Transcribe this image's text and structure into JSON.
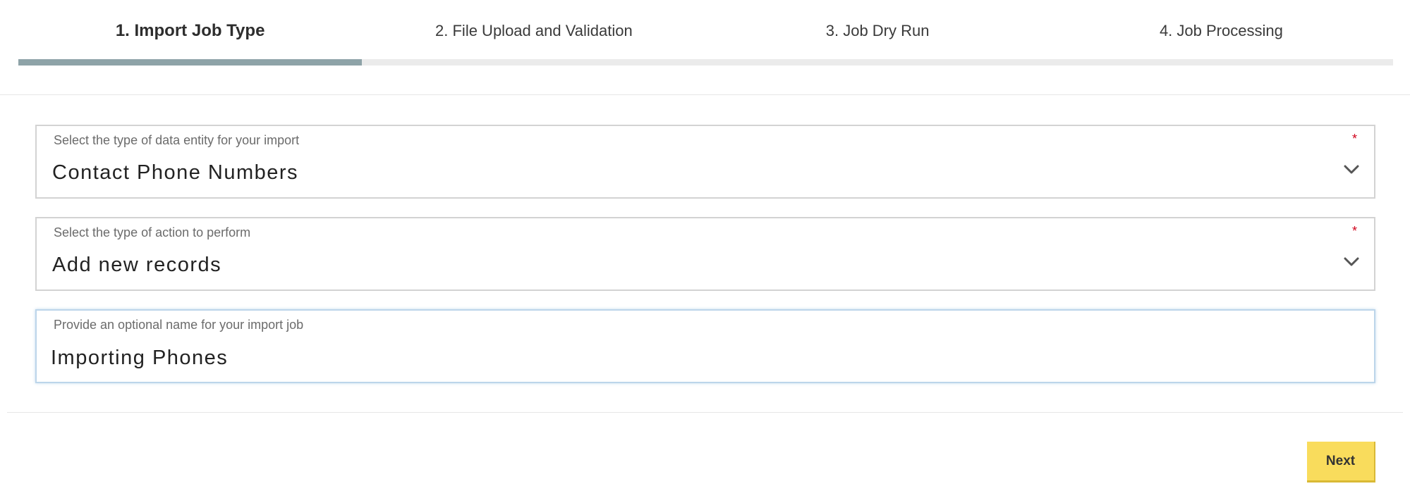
{
  "stepper": {
    "steps": [
      {
        "label": "1. Import Job Type",
        "active": true
      },
      {
        "label": "2. File Upload and Validation",
        "active": false
      },
      {
        "label": "3. Job Dry Run",
        "active": false
      },
      {
        "label": "4. Job Processing",
        "active": false
      }
    ],
    "current_step": 1,
    "total_steps": 4,
    "progress_fraction": 0.25
  },
  "form": {
    "entity_type": {
      "label": "Select the type of data entity for your import",
      "value": "Contact Phone Numbers",
      "required_marker": "*",
      "icon": "chevron-down-icon"
    },
    "action_type": {
      "label": "Select the type of action to perform",
      "value": "Add new records",
      "required_marker": "*",
      "icon": "chevron-down-icon"
    },
    "job_name": {
      "label": "Provide an optional name for your import job",
      "value": "Importing Phones"
    }
  },
  "footer": {
    "next_label": "Next"
  },
  "colors": {
    "progress_fill": "#8ea3a8",
    "progress_track": "#ebebeb",
    "required": "#d0021b",
    "primary_button": "#f9dc5c",
    "focus_border": "#bcd5ea"
  }
}
